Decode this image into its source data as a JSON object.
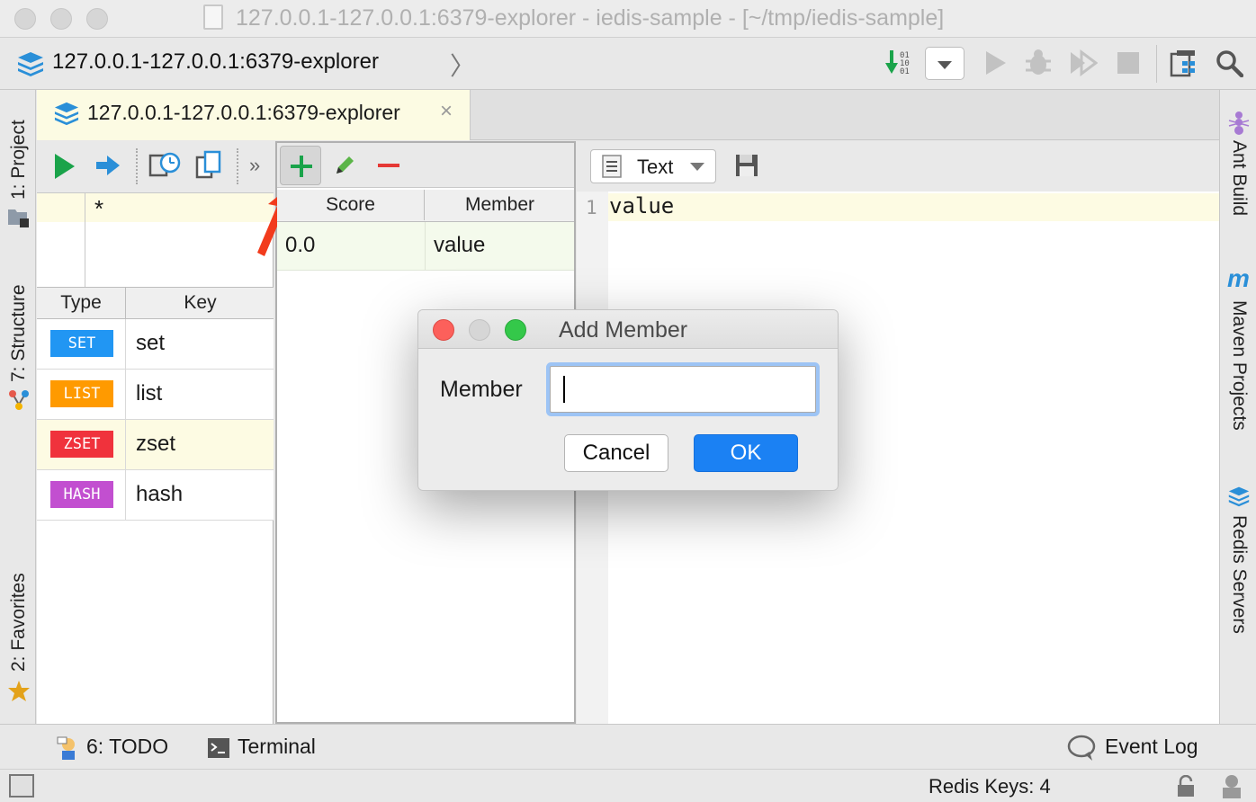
{
  "window": {
    "title": "127.0.0.1-127.0.0.1:6379-explorer - iedis-sample - [~/tmp/iedis-sample]"
  },
  "navbar": {
    "breadcrumb": "127.0.0.1-127.0.0.1:6379-explorer"
  },
  "editor_tab": {
    "label": "127.0.0.1-127.0.0.1:6379-explorer",
    "close": "×"
  },
  "left_strip": {
    "project": "1: Project",
    "structure": "7: Structure",
    "favorites": "2: Favorites"
  },
  "right_strip": {
    "ant_build": "Ant Build",
    "maven_projects": "Maven Projects",
    "redis_servers": "Redis Servers"
  },
  "keys_panel": {
    "more": "»",
    "pattern": "*",
    "columns": [
      "Type",
      "Key"
    ],
    "rows": [
      {
        "type": "SET",
        "key": "set",
        "color": "#2196f3"
      },
      {
        "type": "LIST",
        "key": "list",
        "color": "#ff9a00"
      },
      {
        "type": "ZSET",
        "key": "zset",
        "color": "#f0323c"
      },
      {
        "type": "HASH",
        "key": "hash",
        "color": "#c24fd0"
      }
    ]
  },
  "zset_panel": {
    "columns": [
      "Score",
      "Member"
    ],
    "rows": [
      {
        "score": "0.0",
        "member": "value"
      }
    ]
  },
  "value_panel": {
    "format": "Text",
    "line_number": "1",
    "content": "value"
  },
  "bottom_bar": {
    "todo": "6: TODO",
    "terminal": "Terminal",
    "event_log": "Event Log"
  },
  "status_bar": {
    "redis_keys": "Redis Keys: 4"
  },
  "dialog": {
    "title": "Add Member",
    "field_label": "Member",
    "field_value": "",
    "cancel": "Cancel",
    "ok": "OK"
  },
  "colors": {
    "accent": "#1b81f3",
    "run_green": "#1aa34a",
    "tab_highlight": "#fcfbe3"
  }
}
